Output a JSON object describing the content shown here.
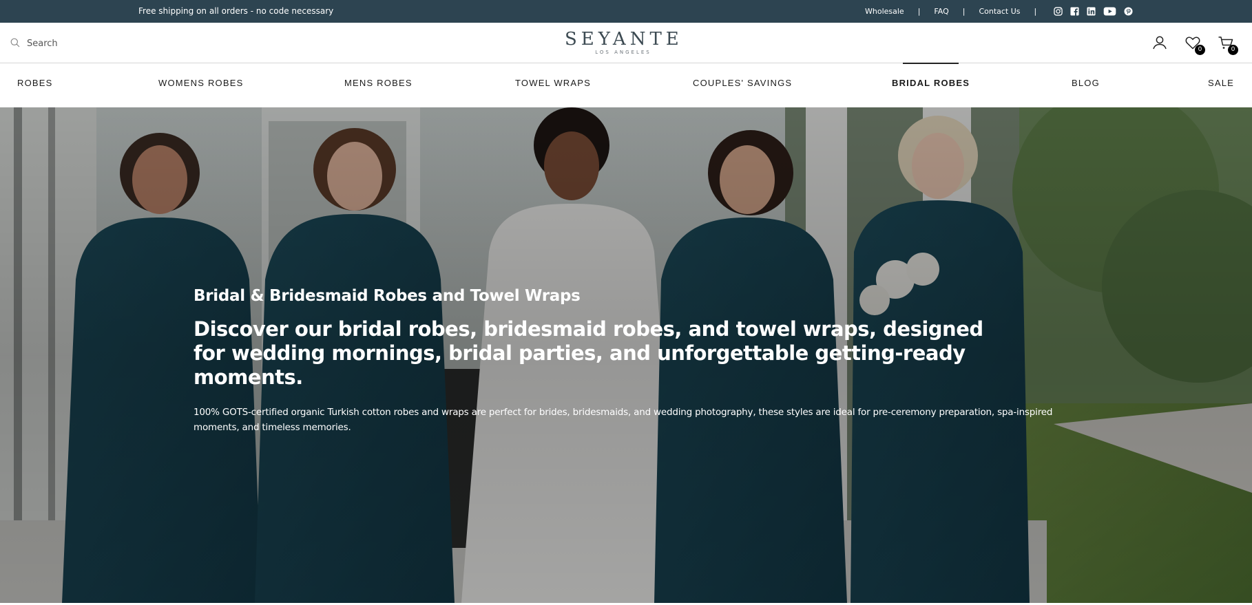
{
  "announcement": {
    "promo": "Free shipping on all orders - no code necessary",
    "links": [
      {
        "label": "Wholesale"
      },
      {
        "label": "FAQ"
      },
      {
        "label": "Contact Us"
      }
    ],
    "separator": "|",
    "social_icons": [
      "instagram-icon",
      "facebook-icon",
      "linkedin-icon",
      "youtube-icon",
      "pinterest-icon"
    ]
  },
  "header": {
    "search": {
      "placeholder": "Search",
      "value": ""
    },
    "logo": {
      "name": "SEYANTE",
      "tagline": "LOS ANGELES"
    },
    "icons": {
      "account": "user-icon",
      "wishlist": {
        "icon": "heart-icon",
        "count": "0"
      },
      "cart": {
        "icon": "cart-icon",
        "count": "0"
      }
    }
  },
  "nav": {
    "items": [
      {
        "label": "ROBES",
        "active": false
      },
      {
        "label": "WOMENS ROBES",
        "active": false
      },
      {
        "label": "MENS ROBES",
        "active": false
      },
      {
        "label": "TOWEL WRAPS",
        "active": false
      },
      {
        "label": "COUPLES' SAVINGS",
        "active": false
      },
      {
        "label": "BRIDAL ROBES",
        "active": true
      },
      {
        "label": "BLOG",
        "active": false
      },
      {
        "label": "SALE",
        "active": false
      }
    ]
  },
  "hero": {
    "eyebrow": "Bridal & Bridesmaid Robes and Towel Wraps",
    "title": "Discover our bridal robes, bridesmaid robes, and towel wraps, designed for wedding mornings, bridal parties, and unforgettable getting-ready moments.",
    "body": "100% GOTS-certified organic Turkish cotton robes and wraps are perfect for brides, bridesmaids, and wedding photography, these styles are ideal for pre-ceremony preparation, spa-inspired moments, and timeless memories."
  },
  "colors": {
    "announcement_bg": "#2d4451",
    "robe_teal": "#163f4f",
    "logo": "#3c4a52",
    "text": "#1a1a1a"
  }
}
